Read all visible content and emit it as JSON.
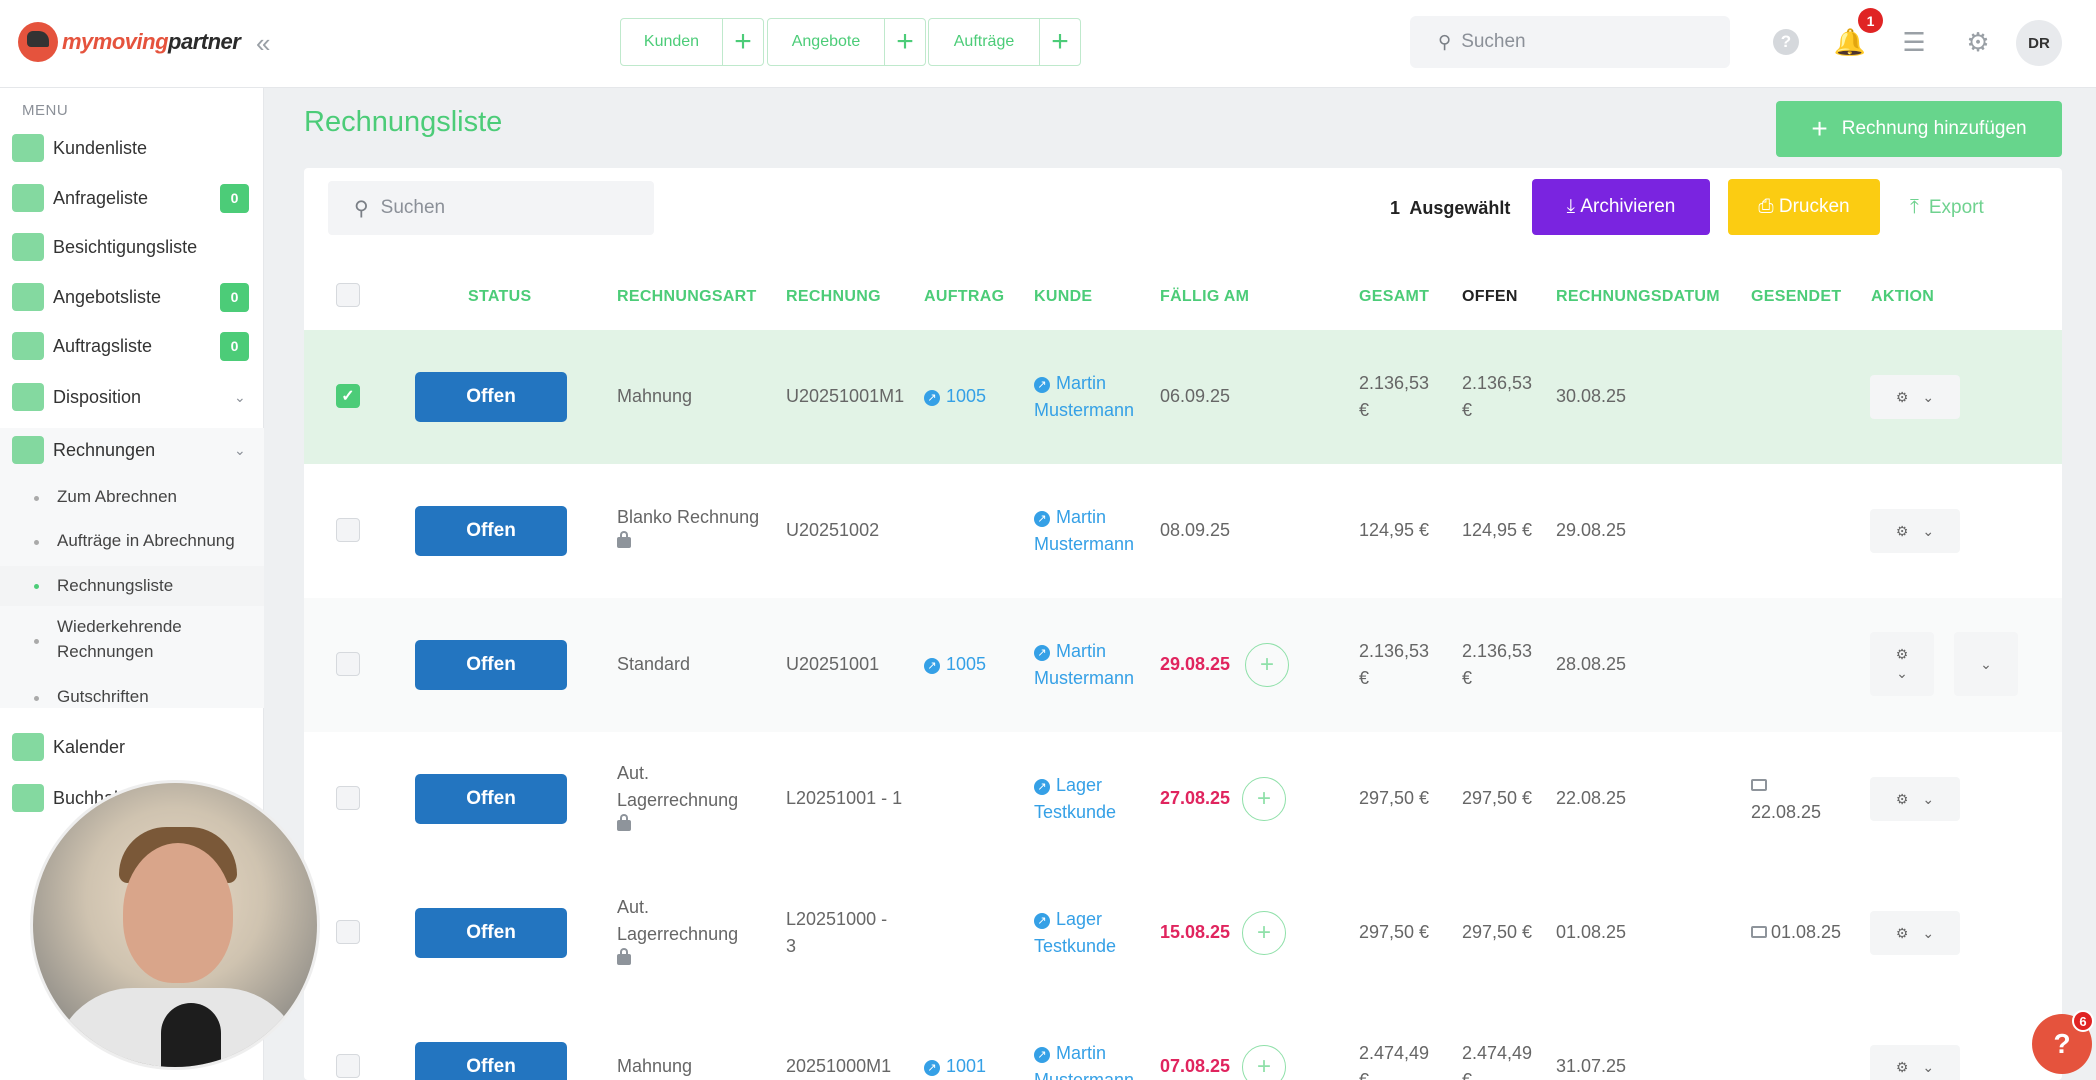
{
  "brand": {
    "logo_a": "my",
    "logo_b": "moving",
    "logo_c": "partner"
  },
  "topbar": {
    "quick": [
      {
        "label": "Kunden"
      },
      {
        "label": "Angebote"
      },
      {
        "label": "Aufträge"
      }
    ],
    "search_placeholder": "Suchen",
    "notification_count": "1",
    "avatar_initials": "DR"
  },
  "sidebar": {
    "menu_header": "MENU",
    "items": [
      {
        "label": "Kundenliste"
      },
      {
        "label": "Anfrageliste",
        "badge": "0"
      },
      {
        "label": "Besichtigungsliste"
      },
      {
        "label": "Angebotsliste",
        "badge": "0"
      },
      {
        "label": "Auftragsliste",
        "badge": "0"
      },
      {
        "label": "Disposition"
      },
      {
        "label": "Rechnungen"
      },
      {
        "label": "Kalender"
      },
      {
        "label": "Buchhaltung"
      }
    ],
    "sub_items": [
      {
        "label": "Zum Abrechnen"
      },
      {
        "label": "Aufträge in Abrechnung"
      },
      {
        "label": "Rechnungsliste"
      },
      {
        "label": "Wiederkehrende Rechnungen"
      },
      {
        "label": "Gutschriften"
      }
    ]
  },
  "main": {
    "title": "Rechnungsliste",
    "add_button": "Rechnung hinzufügen",
    "search_placeholder": "Suchen",
    "selected_count": "1",
    "selected_label": "Ausgewählt",
    "archive_label": "Archivieren",
    "print_label": "Drucken",
    "export_label": "Export",
    "columns": [
      "STATUS",
      "RECHNUNGSART",
      "RECHNUNG",
      "AUFTRAG",
      "KUNDE",
      "FÄLLIG AM",
      "GESAMT",
      "OFFEN",
      "RECHNUNGSDATUM",
      "GESENDET",
      "AKTION"
    ],
    "rows": [
      {
        "status": "Offen",
        "art1": "Mahnung",
        "art2": "",
        "rechnung": "U20251001M1",
        "auftrag": "1005",
        "kunde1": "Martin",
        "kunde2": "Mustermann",
        "faellig": "06.09.25",
        "gesamt1": "2.136,53",
        "gesamt2": "€",
        "offen1": "2.136,53",
        "offen2": "€",
        "datum": "30.08.25",
        "gesendet": ""
      },
      {
        "status": "Offen",
        "art1": "Blanko Rechnung",
        "art2": "",
        "rechnung": "U20251002",
        "auftrag": "",
        "kunde1": "Martin",
        "kunde2": "Mustermann",
        "faellig": "08.09.25",
        "gesamt1": "124,95 €",
        "gesamt2": "",
        "offen1": "124,95 €",
        "offen2": "",
        "datum": "29.08.25",
        "gesendet": ""
      },
      {
        "status": "Offen",
        "art1": "Standard",
        "art2": "",
        "rechnung": "U20251001",
        "auftrag": "1005",
        "kunde1": "Martin",
        "kunde2": "Mustermann",
        "faellig": "29.08.25",
        "gesamt1": "2.136,53",
        "gesamt2": "€",
        "offen1": "2.136,53",
        "offen2": "€",
        "datum": "28.08.25",
        "gesendet": ""
      },
      {
        "status": "Offen",
        "art1": "Aut.",
        "art2": "Lagerrechnung",
        "rechnung": "L20251001 - 1",
        "auftrag": "",
        "kunde1": "Lager",
        "kunde2": "Testkunde",
        "faellig": "27.08.25",
        "gesamt1": "297,50 €",
        "gesamt2": "",
        "offen1": "297,50 €",
        "offen2": "",
        "datum": "22.08.25",
        "gesendet": "22.08.25"
      },
      {
        "status": "Offen",
        "art1": "Aut.",
        "art2": "Lagerrechnung",
        "rechnung": "L20251000 -",
        "rechnung2": "3",
        "auftrag": "",
        "kunde1": "Lager",
        "kunde2": "Testkunde",
        "faellig": "15.08.25",
        "gesamt1": "297,50 €",
        "gesamt2": "",
        "offen1": "297,50 €",
        "offen2": "",
        "datum": "01.08.25",
        "gesendet": "01.08.25"
      },
      {
        "status": "Offen",
        "art1": "Mahnung",
        "art2": "",
        "rechnung": "20251000M1",
        "auftrag": "1001",
        "kunde1": "Martin",
        "kunde2": "Mustermann",
        "faellig": "07.08.25",
        "gesamt1": "2.474,49",
        "gesamt2": "€",
        "offen1": "2.474,49",
        "offen2": "€",
        "datum": "31.07.25",
        "gesendet": ""
      }
    ]
  },
  "support": {
    "help_label": "?",
    "help_badge": "6"
  },
  "colors": {
    "brand": "#4ccc78",
    "status_blue": "#2375c0",
    "archive": "#7a24e0",
    "print": "#fbcc12",
    "overdue": "#e0245e"
  }
}
